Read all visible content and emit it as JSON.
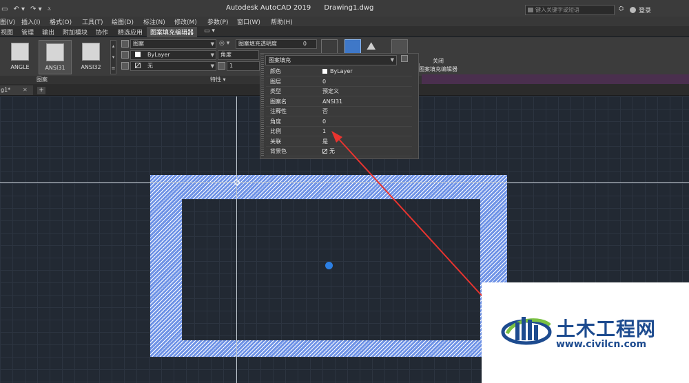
{
  "window": {
    "app_title": "Autodesk AutoCAD 2019",
    "doc_title": "Drawing1.dwg",
    "search_placeholder": "键入关键字或短语",
    "login_label": "登录"
  },
  "menubar": [
    "图(V)",
    "插入(I)",
    "格式(O)",
    "工具(T)",
    "绘图(D)",
    "标注(N)",
    "修改(M)",
    "参数(P)",
    "窗口(W)",
    "帮助(H)"
  ],
  "ribbon_tabs": [
    "视图",
    "管理",
    "输出",
    "附加模块",
    "协作",
    "精选应用",
    "图案填充编辑器"
  ],
  "ribbon": {
    "patterns": [
      {
        "label": "ANGLE",
        "style": "grid",
        "selected": false
      },
      {
        "label": "ANSI31",
        "style": "hatch",
        "selected": true
      },
      {
        "label": "ANSI32",
        "style": "hatch",
        "selected": false
      }
    ],
    "pattern_type_dd": "图案",
    "color_dd": "ByLayer",
    "background_dd": "无",
    "transparency_label": "图案填充透明度",
    "transparency_value": "0",
    "angle_label": "角度",
    "scale_value": "1",
    "close_label_1": "关闭",
    "close_label_2": "图案填充编辑器",
    "panel_pattern": "图案",
    "panel_properties": "特性 ▾",
    "panel_close": "关闭"
  },
  "doc_tab": {
    "name": "g1*",
    "close": "✕",
    "new_tab": "+"
  },
  "properties_panel": {
    "header": "图案填充",
    "rows": [
      {
        "key": "颜色",
        "value": "ByLayer",
        "swatch": "box"
      },
      {
        "key": "图层",
        "value": "0",
        "swatch": ""
      },
      {
        "key": "类型",
        "value": "预定义",
        "swatch": ""
      },
      {
        "key": "图案名",
        "value": "ANSI31",
        "swatch": ""
      },
      {
        "key": "注释性",
        "value": "否",
        "swatch": ""
      },
      {
        "key": "角度",
        "value": "0",
        "swatch": ""
      },
      {
        "key": "比例",
        "value": "1",
        "swatch": ""
      },
      {
        "key": "关联",
        "value": "是",
        "swatch": ""
      },
      {
        "key": "背景色",
        "value": "无",
        "swatch": "none"
      }
    ]
  },
  "watermark": {
    "title": "土木工程网",
    "url": "www.civilcn.com"
  },
  "colors": {
    "hatch": "#6f93e6",
    "grip": "#2c7fe3",
    "arrow": "#e8342f",
    "canvas": "#222933",
    "check": "#3fd07a",
    "watermark_blue": "#1d4b8f"
  }
}
